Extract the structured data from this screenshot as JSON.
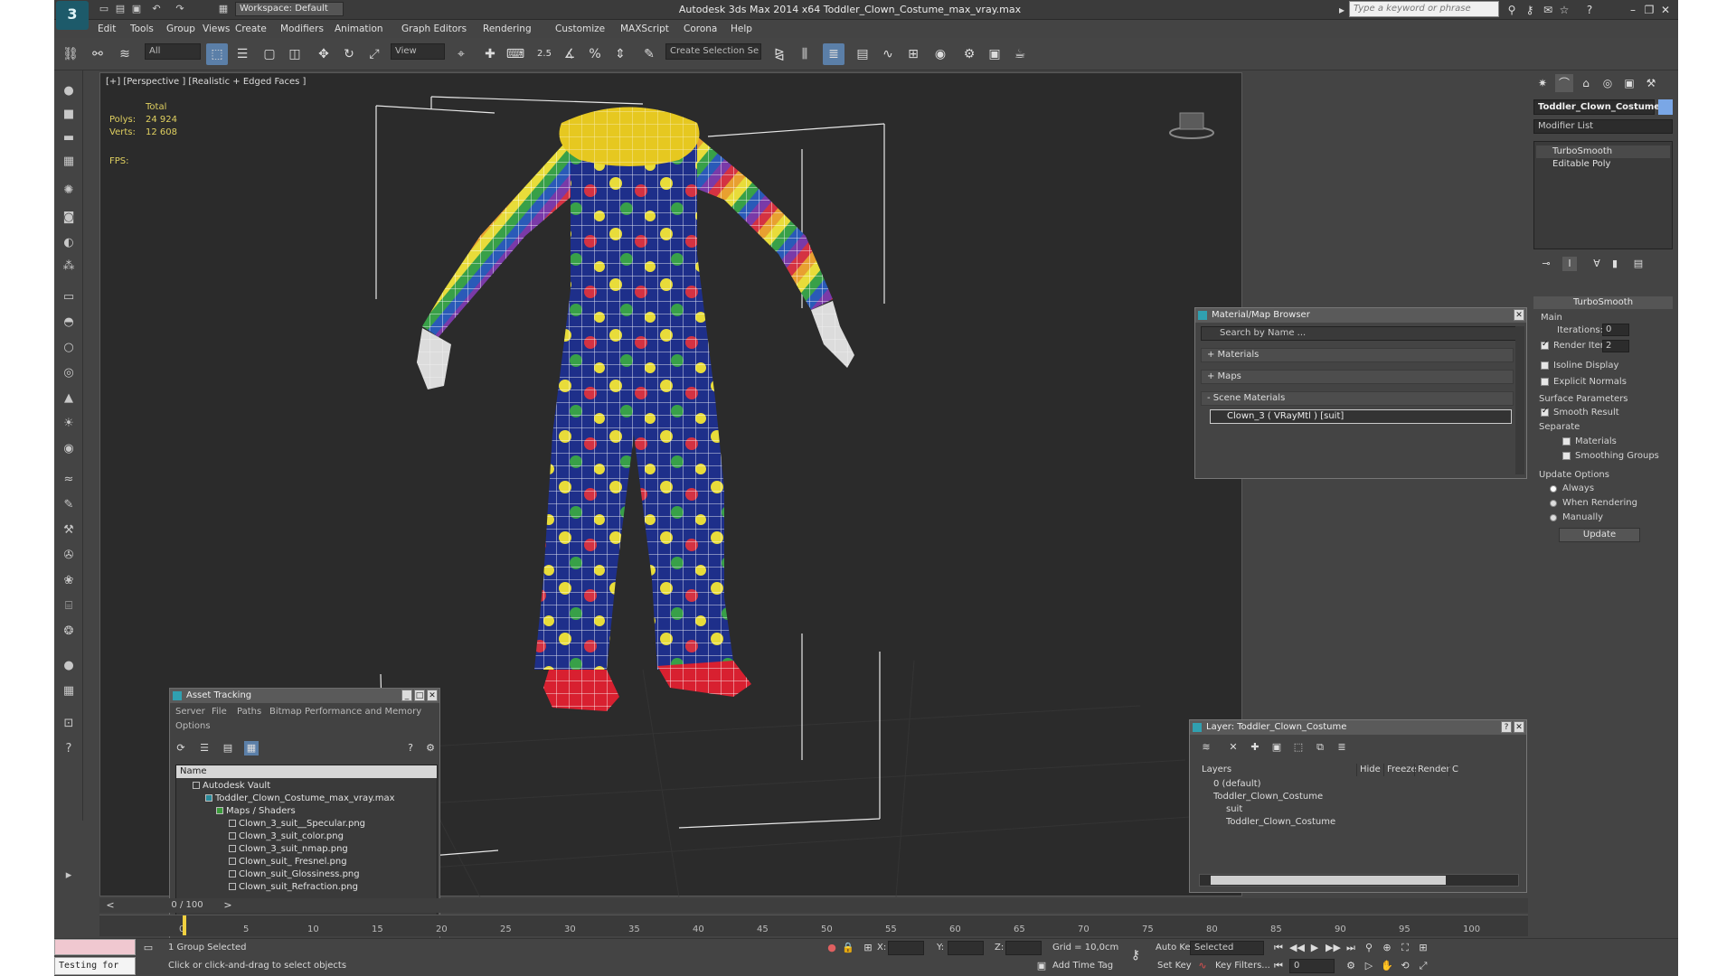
{
  "window": {
    "title": "Autodesk 3ds Max  2014 x64     Toddler_Clown_Costume_max_vray.max",
    "workspace": "Workspace: Default",
    "search_placeholder": "Type a keyword or phrase"
  },
  "menu": [
    "Edit",
    "Tools",
    "Group",
    "Views",
    "Create",
    "Modifiers",
    "Animation",
    "Graph Editors",
    "Rendering",
    "Customize",
    "MAXScript",
    "Corona",
    "Help"
  ],
  "toolbar": {
    "selection_filter": "All",
    "ref_coord": "View",
    "snap_value": "2.5",
    "named_selection": "Create Selection Se"
  },
  "viewport": {
    "label": "[+] [Perspective ] [Realistic + Edged Faces ]",
    "stats_total": "Total",
    "polys_label": "Polys:",
    "polys_value": "24 924",
    "verts_label": "Verts:",
    "verts_value": "12 608",
    "fps_label": "FPS:"
  },
  "asset_tracking": {
    "title": "Asset Tracking",
    "menu": [
      "Server",
      "File",
      "Paths",
      "Bitmap Performance and Memory",
      "Options"
    ],
    "column_name": "Name",
    "rows": [
      {
        "label": "Autodesk Vault"
      },
      {
        "label": "Toddler_Clown_Costume_max_vray.max"
      },
      {
        "label": "Maps / Shaders"
      },
      {
        "label": "Clown_3_suit__Specular.png"
      },
      {
        "label": "Clown_3_suit_color.png"
      },
      {
        "label": "Clown_3_suit_nmap.png"
      },
      {
        "label": "Clown_suit_ Fresnel.png"
      },
      {
        "label": "Clown_suit_Glossiness.png"
      },
      {
        "label": "Clown_suit_Refraction.png"
      }
    ]
  },
  "material_browser": {
    "title": "Material/Map Browser",
    "search_placeholder": "Search by Name ...",
    "materials": "+ Materials",
    "maps": "+ Maps",
    "scene_materials": "- Scene Materials",
    "scene_item": "Clown_3  ( VRayMtl )  [suit]"
  },
  "layer_panel": {
    "title": "Layer: Toddler_Clown_Costume",
    "columns": [
      "Layers",
      "Hide",
      "Freeze",
      "Render",
      "C"
    ],
    "rows": [
      {
        "label": "0 (default)"
      },
      {
        "label": "Toddler_Clown_Costume"
      },
      {
        "label": "suit"
      },
      {
        "label": "Toddler_Clown_Costume"
      }
    ]
  },
  "command_panel": {
    "object_name": "Toddler_Clown_Costume",
    "object_color": "#7aa7e6",
    "modifier_list": "Modifier List",
    "stack": [
      "TurboSmooth",
      "Editable Poly"
    ],
    "turbosmooth": {
      "header": "TurboSmooth",
      "main": "Main",
      "iterations_label": "Iterations:",
      "iterations_value": "0",
      "render_iters_label": "Render Iters:",
      "render_iters_value": "2",
      "isoline": "Isoline Display",
      "explicit_normals": "Explicit Normals",
      "surface_params": "Surface Parameters",
      "smooth_result": "Smooth Result",
      "separate": "Separate",
      "materials": "Materials",
      "smoothing_groups": "Smoothing Groups",
      "update_options": "Update Options",
      "always": "Always",
      "when_rendering": "When Rendering",
      "manually": "Manually",
      "update_button": "Update"
    }
  },
  "timeline": {
    "frame_display": "0 / 100",
    "ticks": [
      "0",
      "5",
      "10",
      "15",
      "20",
      "25",
      "30",
      "35",
      "40",
      "45",
      "50",
      "55",
      "60",
      "65",
      "70",
      "75",
      "80",
      "85",
      "90",
      "95",
      "100"
    ]
  },
  "status": {
    "selection": "1 Group Selected",
    "prompt": "Click or click-and-drag to select objects",
    "maxscript": "Testing for",
    "x_label": "X:",
    "y_label": "Y:",
    "z_label": "Z:",
    "grid": "Grid = 10,0cm",
    "add_time_tag": "Add Time Tag",
    "auto_key": "Auto Key",
    "set_key": "Set Key",
    "selected": "Selected",
    "key_filters": "Key Filters...",
    "frame": "0"
  }
}
